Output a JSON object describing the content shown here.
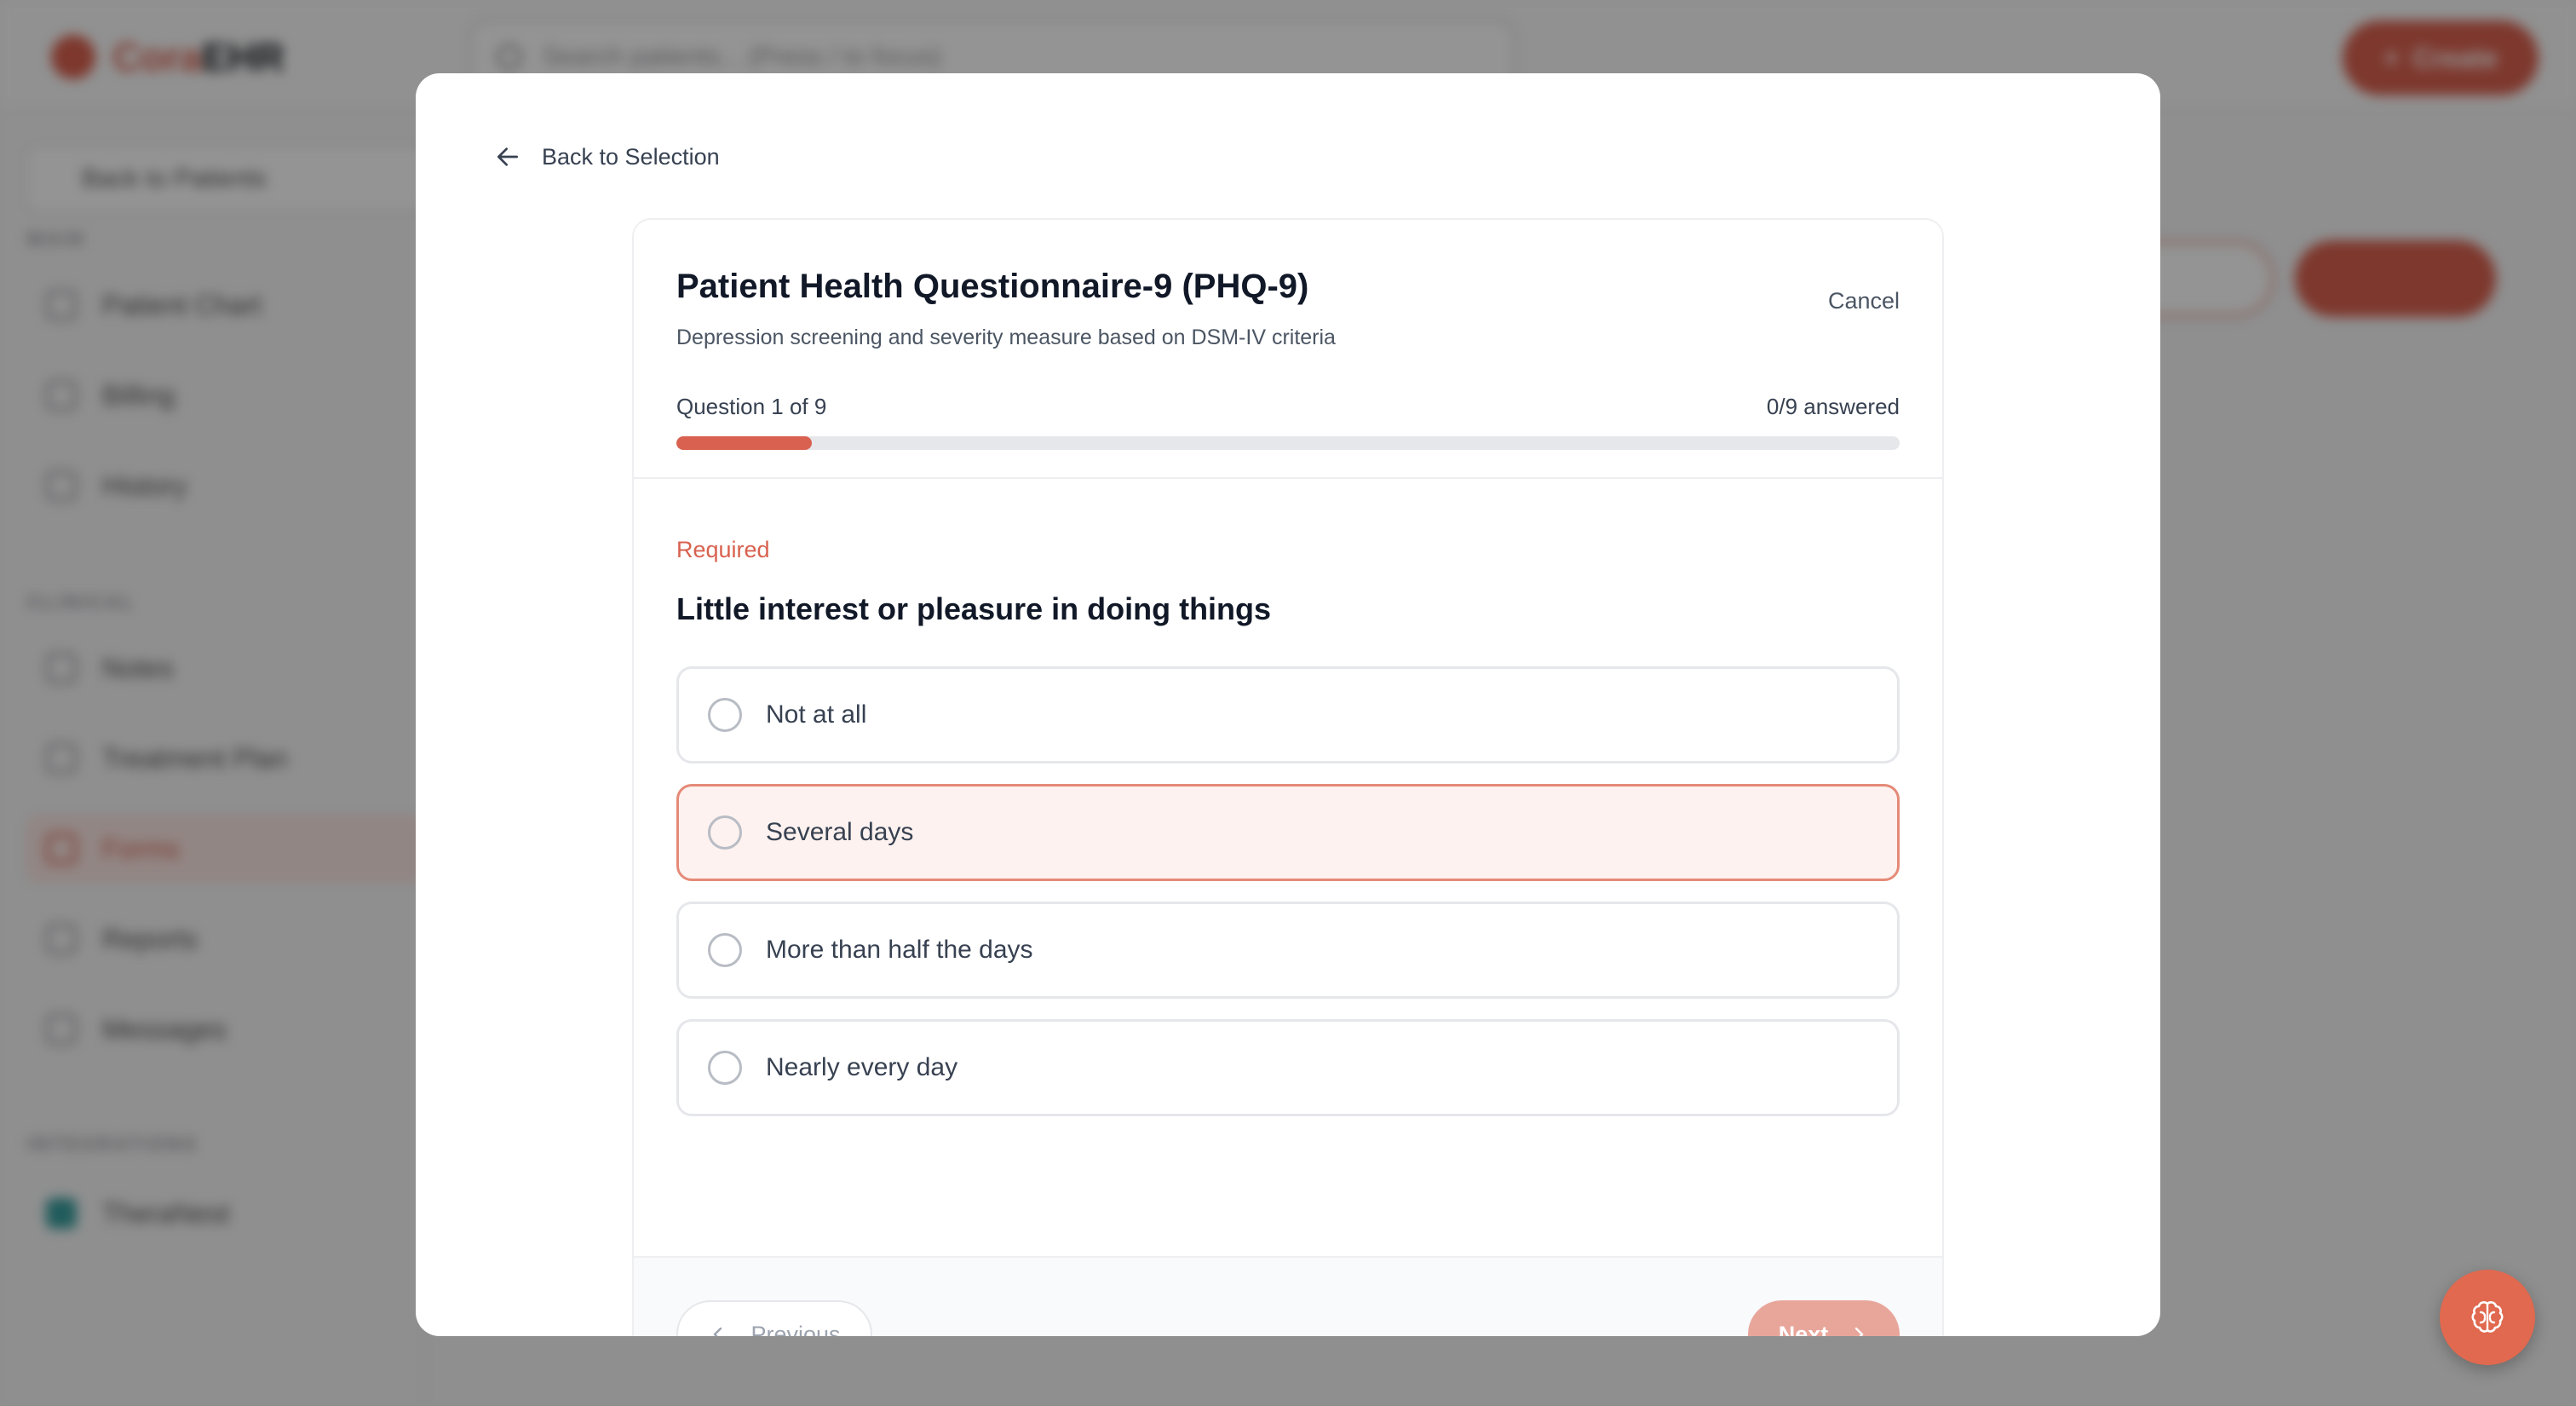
{
  "app": {
    "logo_prefix": "Cora",
    "logo_suffix": "EHR",
    "search_placeholder": "Search patients... (Press / to focus)",
    "create_label": "Create"
  },
  "sidebar": {
    "back_label": "Back to Patients",
    "sections": [
      {
        "title": "MAIN",
        "items": [
          "Patient Chart",
          "Billing",
          "History"
        ]
      },
      {
        "title": "CLINICAL",
        "items": [
          "Notes",
          "Treatment Plan",
          "Forms",
          "Reports",
          "Messages"
        ]
      },
      {
        "title": "INTEGRATIONS",
        "items": [
          "TheraNest"
        ]
      }
    ],
    "active_item": "Forms"
  },
  "modal": {
    "back_label": "Back to Selection",
    "title": "Patient Health Questionnaire-9 (PHQ-9)",
    "subtitle": "Depression screening and severity measure based on DSM-IV criteria",
    "cancel_label": "Cancel",
    "question_counter": "Question 1 of 9",
    "answered_counter": "0/9 answered",
    "progress_fraction": 0.111,
    "required_label": "Required",
    "question_text": "Little interest or pleasure in doing things",
    "options": [
      {
        "label": "Not at all"
      },
      {
        "label": "Several days"
      },
      {
        "label": "More than half the days"
      },
      {
        "label": "Nearly every day"
      }
    ],
    "hovered_option": "Several days",
    "previous_label": "Previous",
    "next_label": "Next"
  },
  "colors": {
    "accent": "#d9614f",
    "accent_light": "#e8a69b",
    "hover_bg": "#fdf2ef"
  },
  "icons": {
    "back": "arrow-left-icon",
    "previous": "chevron-left-icon",
    "next": "chevron-right-icon",
    "assistant": "brain-icon"
  }
}
